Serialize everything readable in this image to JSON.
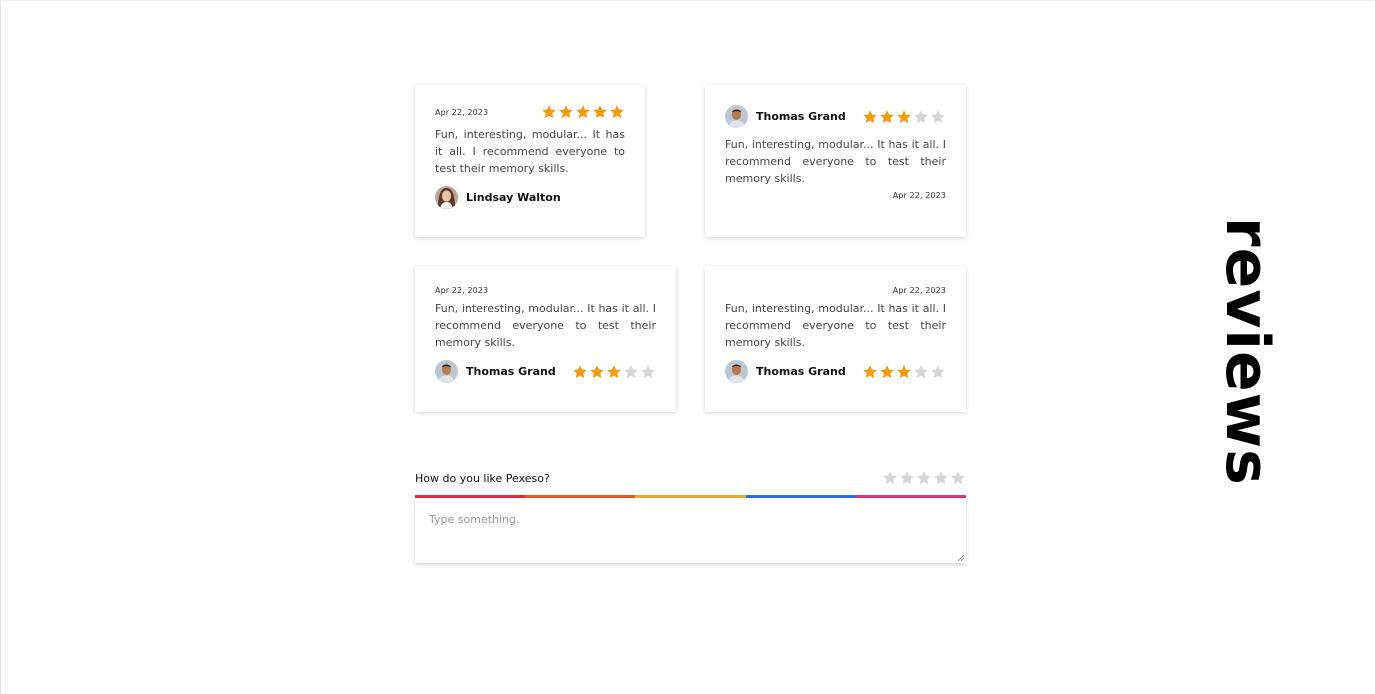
{
  "section_title": "reviews",
  "colors": {
    "star_filled": "#f39c12",
    "star_empty": "#d6d6d6",
    "bar": [
      "#d6303b",
      "#e15c26",
      "#e7ad2e",
      "#2f6fd6",
      "#d63a7a"
    ]
  },
  "reviews": [
    {
      "date": "Apr 22, 2023",
      "rating": 5,
      "text": "Fun, interesting, modular... It has it all. I recommend everyone to test their memory skills.",
      "author": "Lindsay Walton"
    },
    {
      "date": "Apr 22, 2023",
      "rating": 3,
      "text": "Fun, interesting, modular... It has it all. I recommend everyone to test their memory skills.",
      "author": "Thomas Grand"
    },
    {
      "date": "Apr 22, 2023",
      "rating": 3,
      "text": "Fun, interesting, modular... It has it all. I recommend everyone to test their memory skills.",
      "author": "Thomas Grand"
    },
    {
      "date": "Apr 22, 2023",
      "rating": 3,
      "text": "Fun, interesting, modular... It has it all. I recommend everyone to test their memory skills.",
      "author": "Thomas Grand"
    }
  ],
  "feedback": {
    "question": "How do you like Pexeso?",
    "rating": 0,
    "max_rating": 5,
    "placeholder": "Type something.",
    "value": ""
  }
}
